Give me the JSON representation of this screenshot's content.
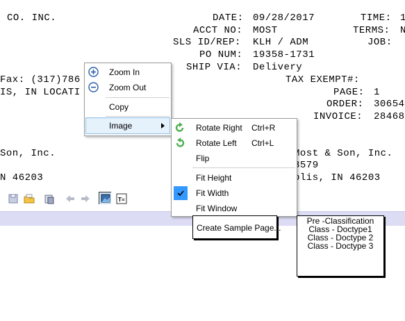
{
  "doc": {
    "company": "CO. INC.",
    "date_label": "DATE:",
    "date_value": "09/28/2017",
    "time_label": "TIME:",
    "time_value": "1",
    "acct_label": "ACCT NO:",
    "acct_value": "MOST",
    "terms_label": "TERMS:",
    "terms_value": "N",
    "sls_label": "SLS ID/REP:",
    "sls_value": "KLH / ADM",
    "job_label": "JOB:",
    "po_label": "PO NUM:",
    "po_value": "19358-1731",
    "ship_label": "SHIP VIA:",
    "ship_value": "Delivery",
    "fax": "Fax: (317)786",
    "tax_label": "TAX EXEMPT#:",
    "location": "IS, IN LOCATI",
    "page_label": "PAGE:",
    "page_value": "1",
    "order_label": "ORDER:",
    "order_value": "30654",
    "invoice_label": "INVOICE:",
    "invoice_value": "28468",
    "son_left": "Son, Inc.",
    "son_right": "Most & Son, Inc.",
    "num_right": "3579",
    "zip_left": "N 46203",
    "zip_right": "olis, IN 46203"
  },
  "context_menu": {
    "zoom_in": "Zoom In",
    "zoom_out": "Zoom Out",
    "copy": "Copy",
    "image": "Image"
  },
  "image_submenu": {
    "rotate_right": "Rotate Right",
    "rotate_right_shortcut": "Ctrl+R",
    "rotate_left": "Rotate Left",
    "rotate_left_shortcut": "Ctrl+L",
    "flip": "Flip",
    "fit_height": "Fit Height",
    "fit_width": "Fit Width",
    "fit_window": "Fit Window",
    "create_sample_page": "Create Sample Page..."
  },
  "classification_box": {
    "items": [
      "Pre -Classification",
      "Class - Doctype1",
      "Class - Doctype 2",
      "Class - Doctype 3"
    ]
  },
  "colors": {
    "accent": "#3399ff",
    "strip": "#dcdcf4",
    "rotate_icon": "#4caf50"
  }
}
